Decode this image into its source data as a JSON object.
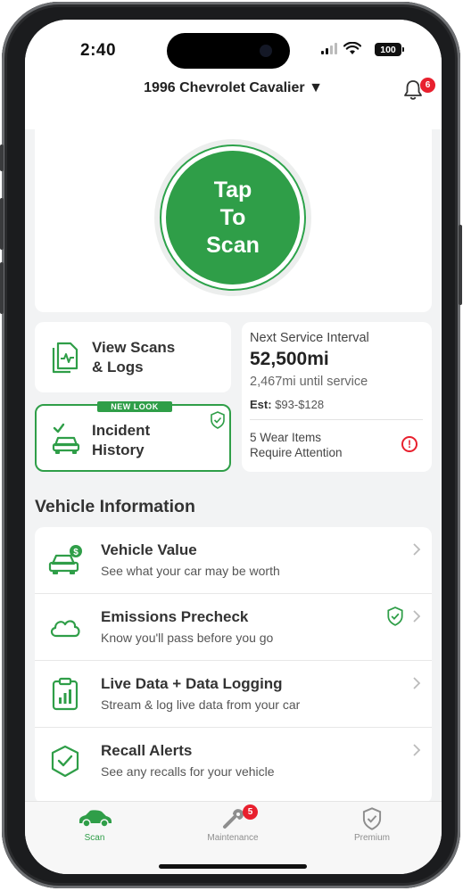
{
  "status_bar": {
    "time": "2:40",
    "battery": "100"
  },
  "header": {
    "vehicle": "1996 Chevrolet Cavalier ▼",
    "notification_count": "6"
  },
  "scan": {
    "label_line1": "Tap",
    "label_line2": "To",
    "label_line3": "Scan"
  },
  "tiles": {
    "view_scans": {
      "line1": "View Scans",
      "line2": "& Logs"
    },
    "incident": {
      "badge": "NEW LOOK",
      "line1": "Incident",
      "line2": "History"
    }
  },
  "service": {
    "title": "Next Service Interval",
    "mileage": "52,500mi",
    "until": "2,467mi until service",
    "est_label": "Est:",
    "est_value": "$93-$128",
    "wear_line1": "5 Wear Items",
    "wear_line2": "Require Attention",
    "alert_symbol": "!"
  },
  "vehicle_info": {
    "section_title": "Vehicle Information",
    "items": [
      {
        "title": "Vehicle Value",
        "subtitle": "See what your car may be worth",
        "icon": "car-dollar-icon"
      },
      {
        "title": "Emissions Precheck",
        "subtitle": "Know you'll pass before you go",
        "icon": "cloud-icon"
      },
      {
        "title": "Live Data + Data Logging",
        "subtitle": "Stream & log live data from your car",
        "icon": "clipboard-chart-icon"
      },
      {
        "title": "Recall Alerts",
        "subtitle": "See any recalls for your vehicle",
        "icon": "shield-check-icon"
      }
    ]
  },
  "tabbar": {
    "tabs": [
      {
        "label": "Scan",
        "icon": "car-icon"
      },
      {
        "label": "Maintenance",
        "icon": "wrench-icon"
      },
      {
        "label": "Premium",
        "icon": "shield-check-icon"
      }
    ],
    "maintenance_badge": "5"
  },
  "colors": {
    "accent": "#2f9e48",
    "alert": "#e8202e",
    "background": "#f2f3f4"
  }
}
